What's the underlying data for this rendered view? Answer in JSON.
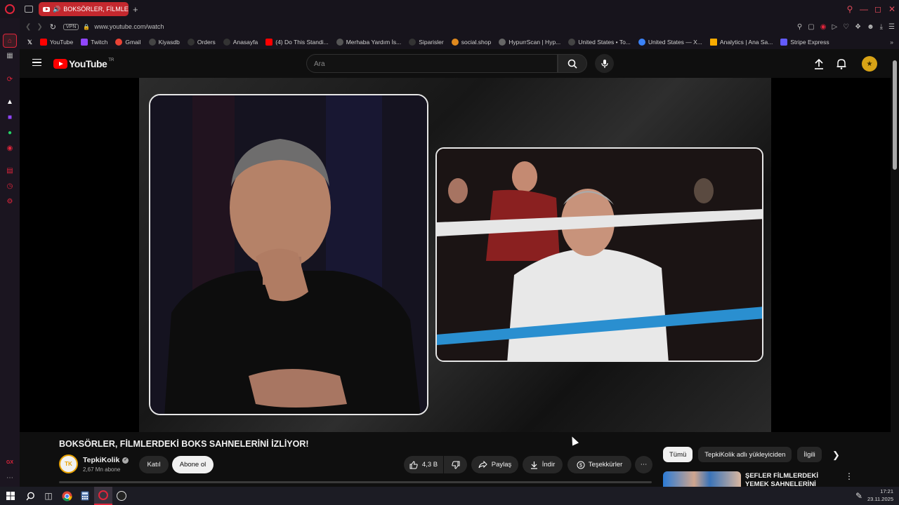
{
  "browser": {
    "tab_title": "BOKSÖRLER, FİLMLERİ",
    "new_tab_symbol": "+",
    "url": "www.youtube.com/watch",
    "vpn_label": "VPN",
    "bookmarks": [
      {
        "label": "YouTube",
        "icon": "youtube-icon",
        "color": "#ff0000"
      },
      {
        "label": "Twitch",
        "icon": "twitch-icon",
        "color": "#9146ff"
      },
      {
        "label": "Gmail",
        "icon": "gmail-icon",
        "color": "#ea4335"
      },
      {
        "label": "Kiyasdb",
        "icon": "a-logo-icon",
        "color": "#444444"
      },
      {
        "label": "Orders",
        "icon": "orders-icon",
        "color": "#333333"
      },
      {
        "label": "Anasayfa",
        "icon": "home-icon",
        "color": "#333333"
      },
      {
        "label": "(4) Do This Standi...",
        "icon": "youtube-icon",
        "color": "#ff0000"
      },
      {
        "label": "Merhaba Yardım İs...",
        "icon": "globe-icon",
        "color": "#555555"
      },
      {
        "label": "Siparisler",
        "icon": "orders-icon",
        "color": "#333333"
      },
      {
        "label": "social.shop",
        "icon": "shop-icon",
        "color": "#e08a1e"
      },
      {
        "label": "HypurrScan | Hyp...",
        "icon": "hypurr-icon",
        "color": "#666666"
      },
      {
        "label": "United States • To...",
        "icon": "trends-icon",
        "color": "#444444"
      },
      {
        "label": "United States — X...",
        "icon": "globe-icon",
        "color": "#3b82f6"
      },
      {
        "label": "Analytics | Ana Sa...",
        "icon": "analytics-icon",
        "color": "#f9ab00"
      },
      {
        "label": "Stripe Express",
        "icon": "stripe-icon",
        "color": "#635bff"
      }
    ]
  },
  "youtube": {
    "logo_text": "YouTube",
    "region": "TR",
    "search_placeholder": "Ara"
  },
  "video": {
    "title": "BOKSÖRLER, FİLMLERDEKİ BOKS SAHNELERİNİ İZLİYOR!",
    "channel_initials": "TK",
    "channel_name": "TepkiKolik",
    "subscribers": "2,67 Mn abone",
    "join_label": "Katıl",
    "subscribe_label": "Abone ol",
    "likes": "4,3 B",
    "share_label": "Paylaş",
    "download_label": "İndir",
    "thanks_label": "Teşekkürler"
  },
  "chips": [
    {
      "label": "Tümü",
      "active": true
    },
    {
      "label": "TepkiKolik adlı yükleyiciden",
      "active": false
    },
    {
      "label": "İlgili",
      "active": false
    }
  ],
  "recommendation": {
    "title": "ŞEFLER FİLMLERDEKİ YEMEK SAHNELERİNİ İZLİYOR!"
  },
  "taskbar": {
    "time": "17:21",
    "date": "23.11.2025"
  },
  "colors": {
    "opera_red": "#e0253b",
    "youtube_red": "#ff0000",
    "background": "#0f0f0f"
  }
}
